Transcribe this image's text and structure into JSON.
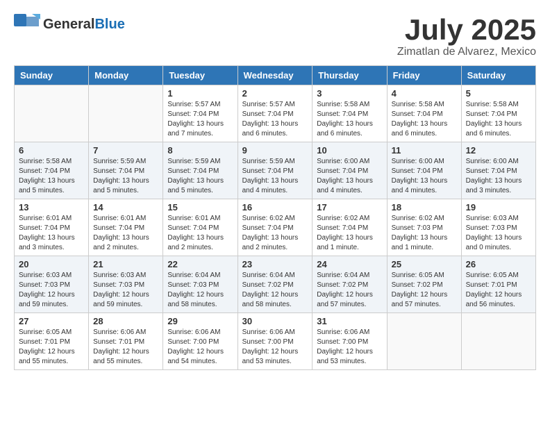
{
  "header": {
    "logo_general": "General",
    "logo_blue": "Blue",
    "month_title": "July 2025",
    "location": "Zimatlan de Alvarez, Mexico"
  },
  "days_of_week": [
    "Sunday",
    "Monday",
    "Tuesday",
    "Wednesday",
    "Thursday",
    "Friday",
    "Saturday"
  ],
  "weeks": [
    [
      {
        "day": "",
        "info": ""
      },
      {
        "day": "",
        "info": ""
      },
      {
        "day": "1",
        "info": "Sunrise: 5:57 AM\nSunset: 7:04 PM\nDaylight: 13 hours and 7 minutes."
      },
      {
        "day": "2",
        "info": "Sunrise: 5:57 AM\nSunset: 7:04 PM\nDaylight: 13 hours and 6 minutes."
      },
      {
        "day": "3",
        "info": "Sunrise: 5:58 AM\nSunset: 7:04 PM\nDaylight: 13 hours and 6 minutes."
      },
      {
        "day": "4",
        "info": "Sunrise: 5:58 AM\nSunset: 7:04 PM\nDaylight: 13 hours and 6 minutes."
      },
      {
        "day": "5",
        "info": "Sunrise: 5:58 AM\nSunset: 7:04 PM\nDaylight: 13 hours and 6 minutes."
      }
    ],
    [
      {
        "day": "6",
        "info": "Sunrise: 5:58 AM\nSunset: 7:04 PM\nDaylight: 13 hours and 5 minutes."
      },
      {
        "day": "7",
        "info": "Sunrise: 5:59 AM\nSunset: 7:04 PM\nDaylight: 13 hours and 5 minutes."
      },
      {
        "day": "8",
        "info": "Sunrise: 5:59 AM\nSunset: 7:04 PM\nDaylight: 13 hours and 5 minutes."
      },
      {
        "day": "9",
        "info": "Sunrise: 5:59 AM\nSunset: 7:04 PM\nDaylight: 13 hours and 4 minutes."
      },
      {
        "day": "10",
        "info": "Sunrise: 6:00 AM\nSunset: 7:04 PM\nDaylight: 13 hours and 4 minutes."
      },
      {
        "day": "11",
        "info": "Sunrise: 6:00 AM\nSunset: 7:04 PM\nDaylight: 13 hours and 4 minutes."
      },
      {
        "day": "12",
        "info": "Sunrise: 6:00 AM\nSunset: 7:04 PM\nDaylight: 13 hours and 3 minutes."
      }
    ],
    [
      {
        "day": "13",
        "info": "Sunrise: 6:01 AM\nSunset: 7:04 PM\nDaylight: 13 hours and 3 minutes."
      },
      {
        "day": "14",
        "info": "Sunrise: 6:01 AM\nSunset: 7:04 PM\nDaylight: 13 hours and 2 minutes."
      },
      {
        "day": "15",
        "info": "Sunrise: 6:01 AM\nSunset: 7:04 PM\nDaylight: 13 hours and 2 minutes."
      },
      {
        "day": "16",
        "info": "Sunrise: 6:02 AM\nSunset: 7:04 PM\nDaylight: 13 hours and 2 minutes."
      },
      {
        "day": "17",
        "info": "Sunrise: 6:02 AM\nSunset: 7:04 PM\nDaylight: 13 hours and 1 minute."
      },
      {
        "day": "18",
        "info": "Sunrise: 6:02 AM\nSunset: 7:03 PM\nDaylight: 13 hours and 1 minute."
      },
      {
        "day": "19",
        "info": "Sunrise: 6:03 AM\nSunset: 7:03 PM\nDaylight: 13 hours and 0 minutes."
      }
    ],
    [
      {
        "day": "20",
        "info": "Sunrise: 6:03 AM\nSunset: 7:03 PM\nDaylight: 12 hours and 59 minutes."
      },
      {
        "day": "21",
        "info": "Sunrise: 6:03 AM\nSunset: 7:03 PM\nDaylight: 12 hours and 59 minutes."
      },
      {
        "day": "22",
        "info": "Sunrise: 6:04 AM\nSunset: 7:03 PM\nDaylight: 12 hours and 58 minutes."
      },
      {
        "day": "23",
        "info": "Sunrise: 6:04 AM\nSunset: 7:02 PM\nDaylight: 12 hours and 58 minutes."
      },
      {
        "day": "24",
        "info": "Sunrise: 6:04 AM\nSunset: 7:02 PM\nDaylight: 12 hours and 57 minutes."
      },
      {
        "day": "25",
        "info": "Sunrise: 6:05 AM\nSunset: 7:02 PM\nDaylight: 12 hours and 57 minutes."
      },
      {
        "day": "26",
        "info": "Sunrise: 6:05 AM\nSunset: 7:01 PM\nDaylight: 12 hours and 56 minutes."
      }
    ],
    [
      {
        "day": "27",
        "info": "Sunrise: 6:05 AM\nSunset: 7:01 PM\nDaylight: 12 hours and 55 minutes."
      },
      {
        "day": "28",
        "info": "Sunrise: 6:06 AM\nSunset: 7:01 PM\nDaylight: 12 hours and 55 minutes."
      },
      {
        "day": "29",
        "info": "Sunrise: 6:06 AM\nSunset: 7:00 PM\nDaylight: 12 hours and 54 minutes."
      },
      {
        "day": "30",
        "info": "Sunrise: 6:06 AM\nSunset: 7:00 PM\nDaylight: 12 hours and 53 minutes."
      },
      {
        "day": "31",
        "info": "Sunrise: 6:06 AM\nSunset: 7:00 PM\nDaylight: 12 hours and 53 minutes."
      },
      {
        "day": "",
        "info": ""
      },
      {
        "day": "",
        "info": ""
      }
    ]
  ]
}
